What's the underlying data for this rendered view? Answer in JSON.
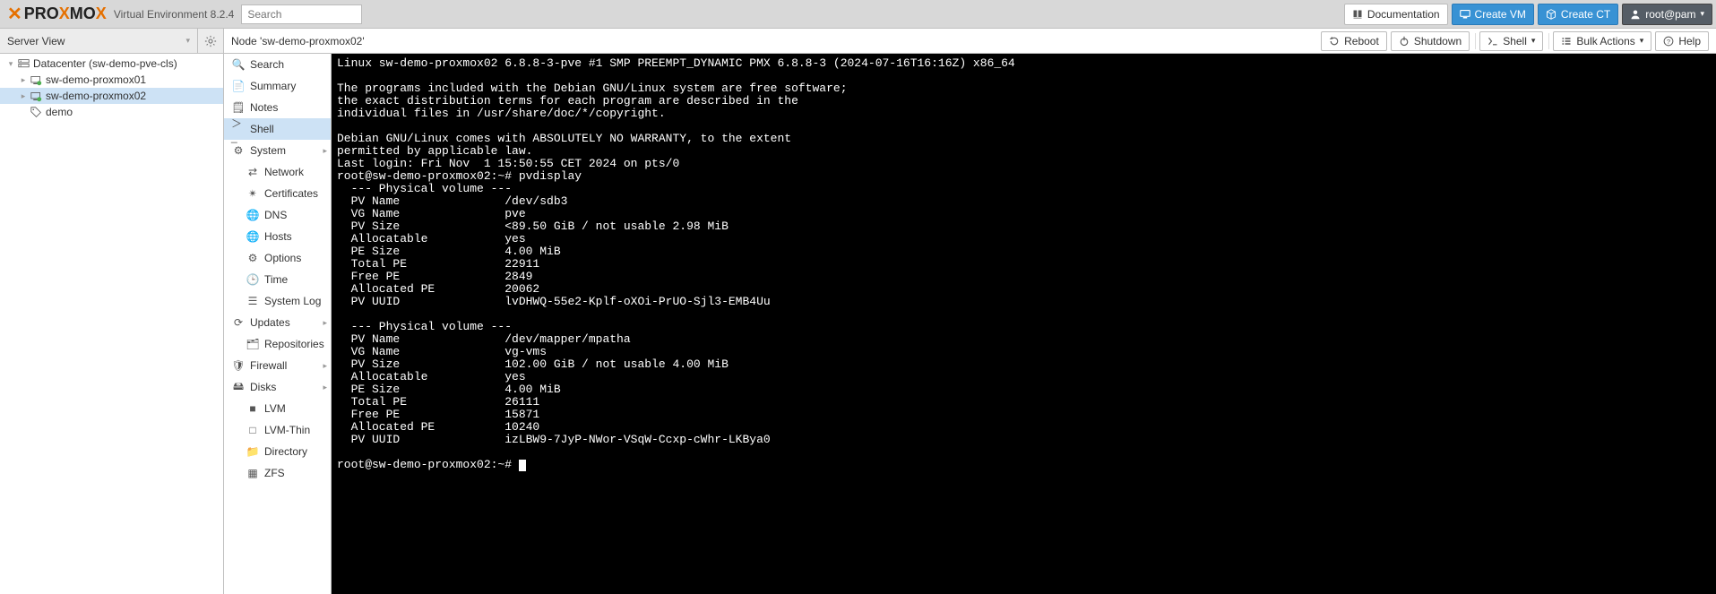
{
  "header": {
    "product": {
      "pre": "PRO",
      "mid": "X",
      "post": "MO",
      "end": "X"
    },
    "version": "Virtual Environment 8.2.4",
    "search_placeholder": "Search",
    "buttons": {
      "documentation": "Documentation",
      "create_vm": "Create VM",
      "create_ct": "Create CT",
      "user": "root@pam"
    }
  },
  "left": {
    "view_label": "Server View",
    "tree": [
      {
        "label": "Datacenter (sw-demo-pve-cls)"
      },
      {
        "label": "sw-demo-proxmox01"
      },
      {
        "label": "sw-demo-proxmox02"
      },
      {
        "label": "demo"
      }
    ]
  },
  "content": {
    "title": "Node 'sw-demo-proxmox02'",
    "buttons": {
      "reboot": "Reboot",
      "shutdown": "Shutdown",
      "shell": "Shell",
      "bulk": "Bulk Actions",
      "help": "Help"
    }
  },
  "sidemenu": {
    "search": "Search",
    "summary": "Summary",
    "notes": "Notes",
    "shell": "Shell",
    "system": "System",
    "network": "Network",
    "certificates": "Certificates",
    "dns": "DNS",
    "hosts": "Hosts",
    "options": "Options",
    "time": "Time",
    "syslog": "System Log",
    "updates": "Updates",
    "repositories": "Repositories",
    "firewall": "Firewall",
    "disks": "Disks",
    "lvm": "LVM",
    "lvmthin": "LVM-Thin",
    "directory": "Directory",
    "zfs": "ZFS"
  },
  "terminal": {
    "lines": [
      "Linux sw-demo-proxmox02 6.8.8-3-pve #1 SMP PREEMPT_DYNAMIC PMX 6.8.8-3 (2024-07-16T16:16Z) x86_64",
      "",
      "The programs included with the Debian GNU/Linux system are free software;",
      "the exact distribution terms for each program are described in the",
      "individual files in /usr/share/doc/*/copyright.",
      "",
      "Debian GNU/Linux comes with ABSOLUTELY NO WARRANTY, to the extent",
      "permitted by applicable law.",
      "Last login: Fri Nov  1 15:50:55 CET 2024 on pts/0",
      "root@sw-demo-proxmox02:~# pvdisplay",
      "  --- Physical volume ---",
      "  PV Name               /dev/sdb3",
      "  VG Name               pve",
      "  PV Size               <89.50 GiB / not usable 2.98 MiB",
      "  Allocatable           yes",
      "  PE Size               4.00 MiB",
      "  Total PE              22911",
      "  Free PE               2849",
      "  Allocated PE          20062",
      "  PV UUID               lvDHWQ-55e2-Kplf-oXOi-PrUO-Sjl3-EMB4Uu",
      "",
      "  --- Physical volume ---",
      "  PV Name               /dev/mapper/mpatha",
      "  VG Name               vg-vms",
      "  PV Size               102.00 GiB / not usable 4.00 MiB",
      "  Allocatable           yes",
      "  PE Size               4.00 MiB",
      "  Total PE              26111",
      "  Free PE               15871",
      "  Allocated PE          10240",
      "  PV UUID               izLBW9-7JyP-NWor-VSqW-Ccxp-cWhr-LKBya0",
      "",
      "root@sw-demo-proxmox02:~# "
    ]
  }
}
